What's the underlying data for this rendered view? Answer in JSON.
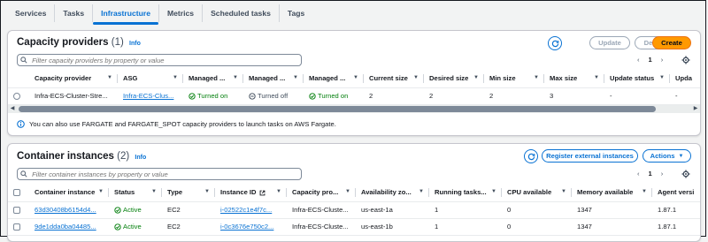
{
  "tabs": [
    {
      "label": "Services"
    },
    {
      "label": "Tasks"
    },
    {
      "label": "Infrastructure"
    },
    {
      "label": "Metrics"
    },
    {
      "label": "Scheduled tasks"
    },
    {
      "label": "Tags"
    }
  ],
  "capacity": {
    "title": "Capacity providers",
    "count": "(1)",
    "info": "Info",
    "buttons": {
      "update": "Update",
      "delete": "Delete",
      "create": "Create"
    },
    "search_placeholder": "Filter capacity providers by property or value",
    "page": "1",
    "columns": [
      "Capacity provider",
      "ASG",
      "Managed ...",
      "Managed ...",
      "Managed ...",
      "Current size",
      "Desired size",
      "Min size",
      "Max size",
      "Update status",
      "Upda"
    ],
    "row": {
      "name": "Infra-ECS-Cluster-Stre...",
      "asg": "Infra-ECS-Clus...",
      "m1": "Turned on",
      "m2": "Turned off",
      "m3": "Turned on",
      "current": "2",
      "desired": "2",
      "min": "2",
      "max": "3",
      "update_status": "-",
      "upda": "-"
    },
    "notice": "You can also use FARGATE and FARGATE_SPOT capacity providers to launch tasks on AWS Fargate."
  },
  "container": {
    "title": "Container instances",
    "count": "(2)",
    "info": "Info",
    "buttons": {
      "register": "Register external instances",
      "actions": "Actions"
    },
    "search_placeholder": "Filter container instances by property or value",
    "page": "1",
    "columns": [
      "Container instance",
      "Status",
      "Type",
      "Instance ID",
      "Capacity pro...",
      "Availability zo...",
      "Running tasks...",
      "CPU available",
      "Memory available",
      "Agent versi"
    ],
    "rows": [
      {
        "id": "63d30408b6154d4...",
        "status": "Active",
        "type": "EC2",
        "instance": "i-02522c1e4f7c...",
        "cap": "Infra-ECS-Cluste...",
        "az": "us-east-1a",
        "running": "1",
        "cpu": "0",
        "mem": "1347",
        "agent": "1.87.1"
      },
      {
        "id": "9de1dda0ba04485...",
        "status": "Active",
        "type": "EC2",
        "instance": "i-0c3676e750c2...",
        "cap": "Infra-ECS-Cluste...",
        "az": "us-east-1b",
        "running": "1",
        "cpu": "0",
        "mem": "1347",
        "agent": "1.87.1"
      }
    ]
  },
  "colors": {
    "accent": "#0972d3",
    "primary": "#ff9900",
    "success": "#037f0c"
  }
}
